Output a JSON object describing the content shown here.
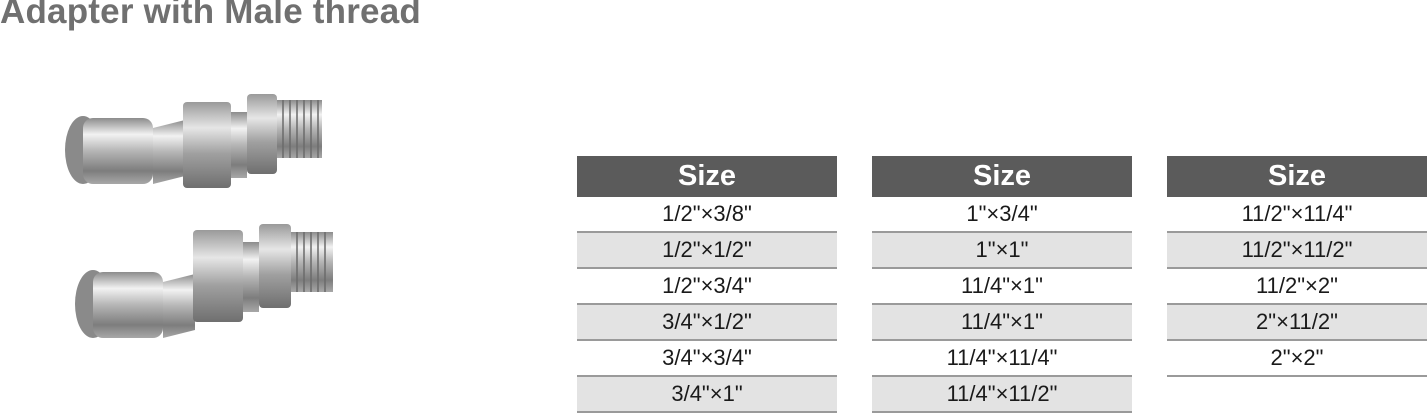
{
  "title": "Adapter with Male thread",
  "tables": [
    {
      "header": "Size",
      "rows": [
        "1/2\"×3/8\"",
        "1/2\"×1/2\"",
        "1/2\"×3/4\"",
        "3/4\"×1/2\"",
        "3/4\"×3/4\"",
        "3/4\"×1\""
      ]
    },
    {
      "header": "Size",
      "rows": [
        "1\"×3/4\"",
        "1\"×1\"",
        "11/4\"×1\"",
        "11/4\"×1\"",
        "11/4\"×11/4\"",
        "11/4\"×11/2\""
      ]
    },
    {
      "header": "Size",
      "rows": [
        "11/2\"×11/4\"",
        "11/2\"×11/2\"",
        "11/2\"×2\"",
        "2\"×11/2\"",
        "2\"×2\""
      ]
    }
  ],
  "colors": {
    "title": "#707070",
    "header_bg": "#5b5b5b",
    "alt_row_bg": "#e3e3e3",
    "divider": "#9a9a9a"
  }
}
